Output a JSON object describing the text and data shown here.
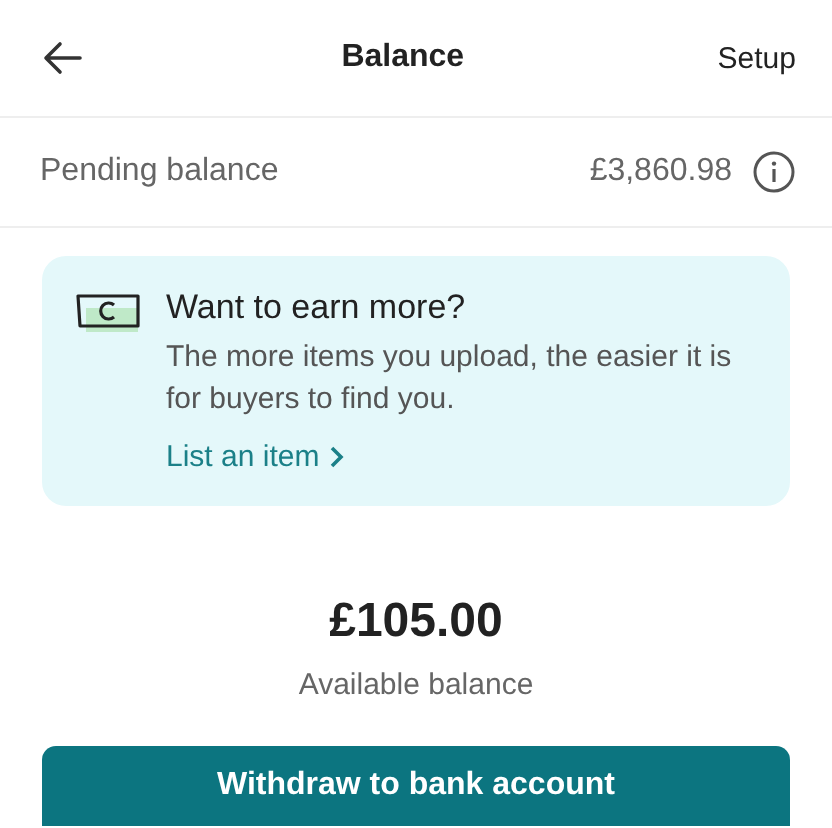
{
  "header": {
    "title": "Balance",
    "action": "Setup"
  },
  "pending": {
    "label": "Pending balance",
    "amount": "£3,860.98"
  },
  "promo": {
    "title": "Want to earn more?",
    "body": "The more items you upload, the easier it is for buyers to find you.",
    "link": "List an item"
  },
  "available": {
    "amount": "£105.00",
    "label": "Available balance"
  },
  "primary_button": {
    "label": "Withdraw to bank account"
  }
}
